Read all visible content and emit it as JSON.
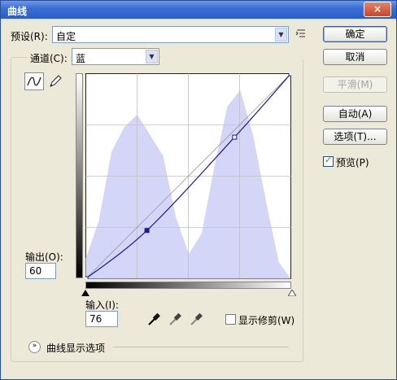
{
  "window": {
    "title": "曲线",
    "close_label": "×"
  },
  "preset": {
    "label": "预设(R):",
    "value": "自定"
  },
  "channel": {
    "label": "通道(C):",
    "value": "蓝"
  },
  "buttons": {
    "ok": "确定",
    "cancel": "取消",
    "smooth": "平滑(M)",
    "auto": "自动(A)",
    "options": "选项(T)..."
  },
  "preview": {
    "label": "预览(P)",
    "checked": true
  },
  "output": {
    "label": "输出(O):",
    "value": "60"
  },
  "input": {
    "label": "输入(I):",
    "value": "76"
  },
  "show_clipping": {
    "label": "显示修剪(W)",
    "checked": false
  },
  "curve_display": {
    "label": "曲线显示选项"
  },
  "icons": [
    "preset-options-icon",
    "curve-tool-icon",
    "pencil-tool-icon",
    "black-point-eyedropper-icon",
    "gray-point-eyedropper-icon",
    "white-point-eyedropper-icon",
    "expand-chevron-icon",
    "black-slider-icon",
    "white-slider-icon"
  ],
  "colors": {
    "histogram": "#d4d6f8",
    "curve": "#1a1a96",
    "title_bar": "#3c6fd6"
  },
  "chart_data": {
    "type": "area",
    "x": [
      0,
      16,
      32,
      48,
      64,
      80,
      96,
      112,
      128,
      144,
      160,
      176,
      192,
      208,
      224,
      240,
      255
    ],
    "histogram": [
      0.1,
      0.28,
      0.62,
      0.74,
      0.8,
      0.7,
      0.6,
      0.3,
      0.12,
      0.22,
      0.55,
      0.84,
      0.92,
      0.7,
      0.38,
      0.08,
      0.0
    ],
    "curve_points": [
      [
        0,
        0
      ],
      [
        76,
        60
      ],
      [
        185,
        176
      ],
      [
        255,
        255
      ]
    ],
    "xlim": [
      0,
      255
    ],
    "ylim": [
      0,
      255
    ],
    "grid": true,
    "grid_divisions": 4
  }
}
